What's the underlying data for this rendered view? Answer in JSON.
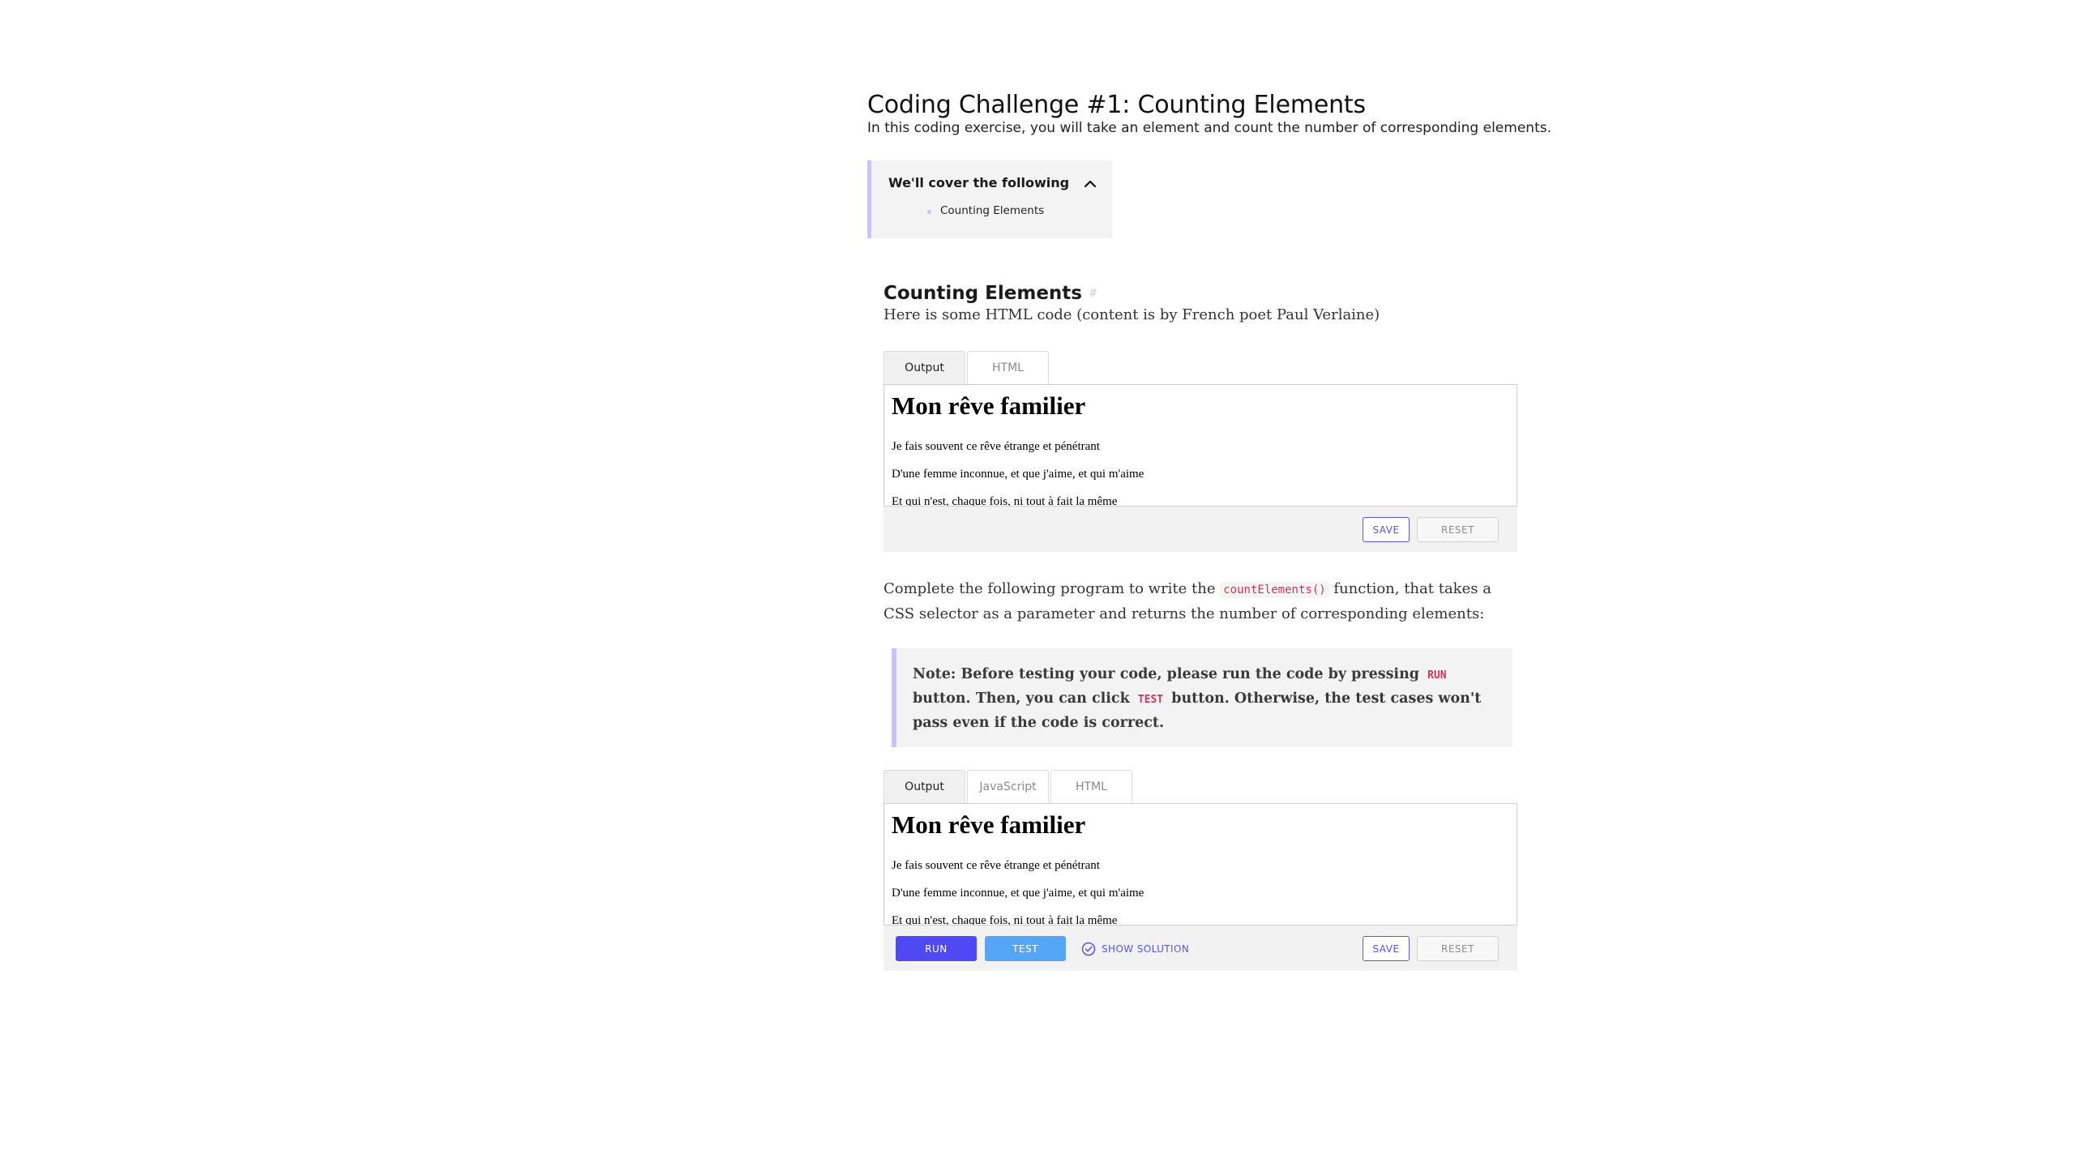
{
  "lesson": {
    "title": "Coding Challenge #1: Counting Elements",
    "subtitle": "In this coding exercise, you will take an element and count the number of corresponding elements."
  },
  "cover": {
    "title": "We'll cover the following",
    "items": [
      "Counting Elements"
    ]
  },
  "section": {
    "heading": "Counting Elements",
    "intro": "Here is some HTML code (content is by French poet Paul Verlaine)"
  },
  "widget1": {
    "tabs": [
      "Output",
      "HTML"
    ],
    "save_label": "SAVE",
    "reset_label": "RESET"
  },
  "poem": {
    "title": "Mon rêve familier",
    "lines": [
      "Je fais souvent ce rêve étrange et pénétrant",
      "D'une femme inconnue, et que j'aime, et qui m'aime",
      "Et qui n'est, chaque fois, ni tout à fait la même"
    ]
  },
  "description": {
    "before": "Complete the following program to write the ",
    "code": "countElements()",
    "after": " function, that takes a CSS selector as a parameter and returns the number of corresponding elements:"
  },
  "note": {
    "part1": "Note: Before testing your code, please run the code by pressing ",
    "code1": "RUN",
    "part2": " button. Then, you can click ",
    "code2": "TEST",
    "part3": " button. Otherwise, the test cases won't pass even if the code is correct."
  },
  "widget2": {
    "tabs": [
      "Output",
      "JavaScript",
      "HTML"
    ],
    "run_label": "RUN",
    "test_label": "TEST",
    "show_solution_label": "SHOW SOLUTION",
    "save_label": "SAVE",
    "reset_label": "RESET"
  },
  "colors": {
    "accent": "#5148f5",
    "test": "#55a7f5",
    "quote_bar": "#c9c4f5",
    "code": "#d3345a"
  }
}
